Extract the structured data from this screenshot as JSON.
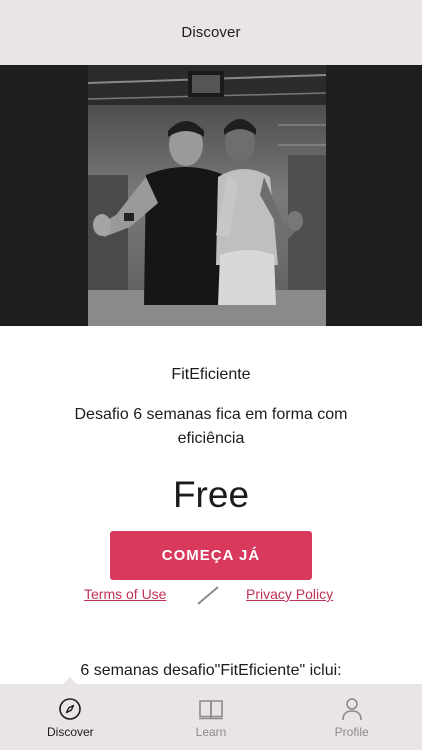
{
  "header": {
    "title": "Discover"
  },
  "hero": {
    "image": "gym-photo-trainer-and-client-thumbs-up"
  },
  "app": {
    "name": "FitEficiente",
    "description": "Desafio 6 semanas fica em forma com eficiência",
    "price": "Free",
    "cta_label": "COMEÇA JÁ",
    "terms_label": "Terms of Use",
    "privacy_label": "Privacy Policy",
    "includes_heading": "6 semanas desafio\"FitEficiente\" iclui:"
  },
  "tabbar": {
    "tabs": [
      {
        "label": "Discover",
        "icon": "compass-icon",
        "active": true
      },
      {
        "label": "Learn",
        "icon": "book-icon",
        "active": false
      },
      {
        "label": "Profile",
        "icon": "person-icon",
        "active": false
      }
    ]
  },
  "colors": {
    "accent": "#d8395c",
    "link": "#c03355",
    "bar_background": "#e9e5e5",
    "hero_background": "#1e1e1e"
  }
}
